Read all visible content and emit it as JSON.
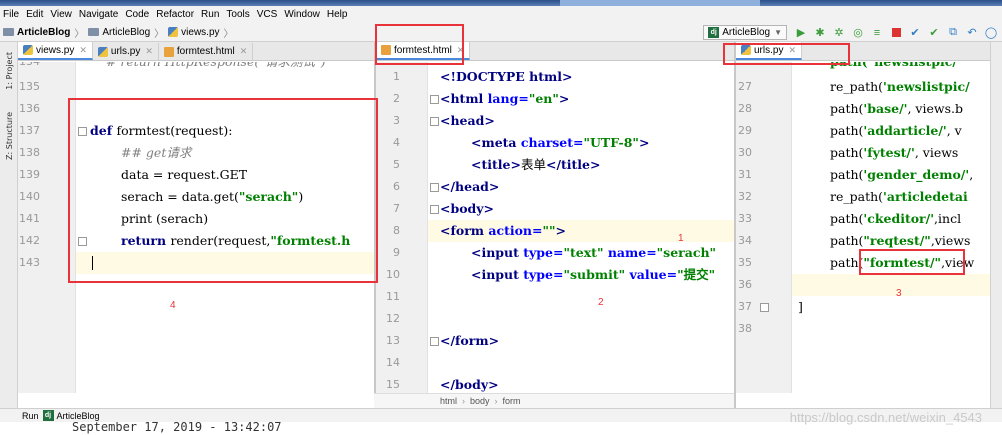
{
  "menu": [
    "File",
    "Edit",
    "View",
    "Navigate",
    "Code",
    "Refactor",
    "Run",
    "Tools",
    "VCS",
    "Window",
    "Help"
  ],
  "breadcrumb": {
    "project": "ArticleBlog",
    "folder": "ArticleBlog",
    "file": "views.py"
  },
  "run_config": "ArticleBlog",
  "side_tabs": {
    "project": "1: Project",
    "structure": "Z: Structure"
  },
  "tabs_left": [
    {
      "label": "views.py",
      "active": true
    },
    {
      "label": "urls.py",
      "active": false
    },
    {
      "label": "formtest.html",
      "active": false
    }
  ],
  "tabs_middle": [
    {
      "label": "formtest.html",
      "active": true
    }
  ],
  "tabs_right": [
    {
      "label": "urls.py",
      "active": true
    }
  ],
  "left_pane": {
    "line_numbers": [
      "134",
      "135",
      "136",
      "137",
      "138",
      "139",
      "140",
      "141",
      "142",
      "143"
    ],
    "lines": {
      "l134": "    # return HttpResponse(\"请求测试\")",
      "l137_kw": "def ",
      "l137_rest": "formtest(request):",
      "l138": "## get请求",
      "l139": "data = request.GET",
      "l140_a": "serach = data.get(",
      "l140_s": "\"serach\"",
      "l140_b": ")",
      "l141": "print (serach)",
      "l142_kw": "return ",
      "l142_a": "render(request,",
      "l142_s": "\"formtest.h"
    }
  },
  "middle_pane": {
    "line_numbers": [
      "1",
      "2",
      "3",
      "4",
      "5",
      "6",
      "7",
      "8",
      "9",
      "10",
      "11",
      "12",
      "13",
      "14",
      "15"
    ],
    "lines": {
      "l1": "<!DOCTYPE html>",
      "l2_tag": "<html ",
      "l2_attr": "lang=",
      "l2_str": "\"en\"",
      "l2_end": ">",
      "l3": "<head>",
      "l4_tag": "<meta ",
      "l4_attr": "charset=",
      "l4_str": "\"UTF-8\"",
      "l4_end": ">",
      "l5_tag": "<title>",
      "l5_text": "表单",
      "l5_end": "</title>",
      "l6": "</head>",
      "l7": "<body>",
      "l8_tag": "<form ",
      "l8_attr": "action=",
      "l8_str": "\"\"",
      "l8_end": ">",
      "l9_tag": "<input ",
      "l9_a1": "type=",
      "l9_s1": "\"text\" ",
      "l9_a2": "name=",
      "l9_s2": "\"serach\"",
      "l10_tag": "<input ",
      "l10_a1": "type=",
      "l10_s1": "\"submit\" ",
      "l10_a2": "value=",
      "l10_s2": "\"提交\"",
      "l13": "</form>",
      "l15": "</body>"
    },
    "footer_crumbs": [
      "html",
      "body",
      "form"
    ]
  },
  "right_pane": {
    "line_numbers": [
      "27",
      "28",
      "29",
      "30",
      "31",
      "32",
      "33",
      "34",
      "35",
      "36",
      "37",
      "38"
    ],
    "lines": {
      "l26": "path(\"newslistpic/\"",
      "l27_a": "re_path(",
      "l27_s": "'newslistpic/",
      "l28_a": "path(",
      "l28_s": "'base/'",
      "l28_b": ", views.b",
      "l29_a": "path(",
      "l29_s": "'addarticle/'",
      "l29_b": ", v",
      "l30_a": "path(",
      "l30_s": "'fytest/'",
      "l30_b": ", views",
      "l31_a": "path(",
      "l31_s": "'gender_demo/'",
      "l31_b": ",",
      "l32_a": "re_path(",
      "l32_s": "'articledetai",
      "l33_a": "path(",
      "l33_s": "'ckeditor/'",
      "l33_b": ",incl",
      "l34_a": "path(",
      "l34_s": "\"reqtest/\"",
      "l34_b": ",views",
      "l35_a": "path(",
      "l35_s": "\"formtest/\"",
      "l35_b": ",view",
      "l37": "]"
    }
  },
  "annotations": [
    "1",
    "2",
    "3",
    "4"
  ],
  "run_bar": {
    "label": "Run",
    "config": "ArticleBlog"
  },
  "console_text": "September 17, 2019 - 13:42:07",
  "watermark": "https://blog.csdn.net/weixin_4543"
}
